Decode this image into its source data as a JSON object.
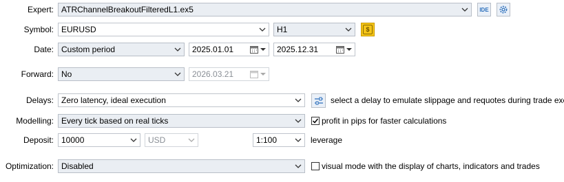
{
  "expert": {
    "label": "Expert:",
    "value": "ATRChannelBreakoutFilteredL1.ex5",
    "ide_label": "IDE",
    "settings_icon": "gear-icon"
  },
  "symbol": {
    "label": "Symbol:",
    "value": "EURUSD",
    "timeframe": "H1",
    "spec_icon": "dollar-icon"
  },
  "date": {
    "label": "Date:",
    "value": "Custom period",
    "from": "2025.01.01",
    "to": "2025.12.31"
  },
  "forward": {
    "label": "Forward:",
    "value": "No",
    "date": "2026.03.21"
  },
  "delays": {
    "label": "Delays:",
    "value": "Zero latency, ideal execution",
    "hint": "select a delay to emulate slippage and requotes during trade execution"
  },
  "modelling": {
    "label": "Modelling:",
    "value": "Every tick based on real ticks",
    "pips_checkbox_label": "profit in pips for faster calculations",
    "pips_checked": true
  },
  "deposit": {
    "label": "Deposit:",
    "value": "10000",
    "currency": "USD",
    "leverage_value": "1:100",
    "leverage_label": "leverage"
  },
  "optimization": {
    "label": "Optimization:",
    "value": "Disabled",
    "visual_label": "visual mode with the display of charts, indicators and trades",
    "visual_checked": false
  },
  "colors": {
    "accent": "#2a6ebb",
    "dollar_button_bg": "#f5c518",
    "select_bg": "#eaeef3"
  }
}
